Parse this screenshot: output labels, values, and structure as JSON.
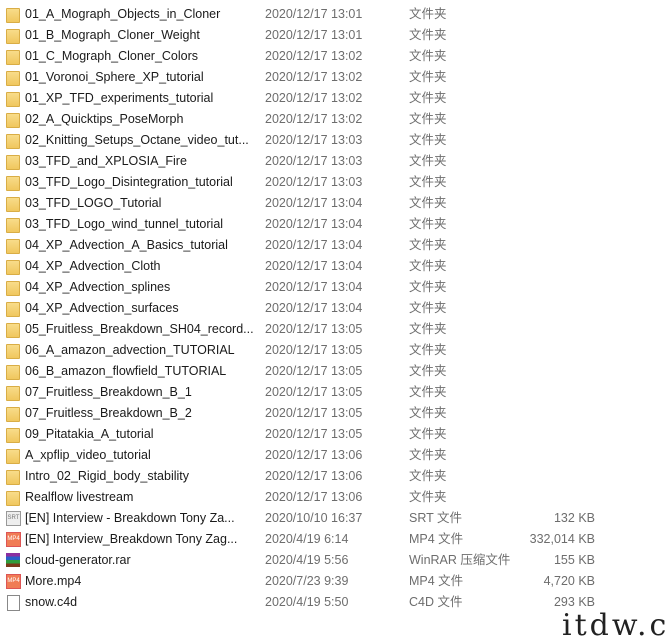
{
  "files": [
    {
      "name": "01_A_Mograph_Objects_in_Cloner",
      "date": "2020/12/17 13:01",
      "type": "文件夹",
      "size": "",
      "icon": "folder"
    },
    {
      "name": "01_B_Mograph_Cloner_Weight",
      "date": "2020/12/17 13:01",
      "type": "文件夹",
      "size": "",
      "icon": "folder"
    },
    {
      "name": "01_C_Mograph_Cloner_Colors",
      "date": "2020/12/17 13:02",
      "type": "文件夹",
      "size": "",
      "icon": "folder"
    },
    {
      "name": "01_Voronoi_Sphere_XP_tutorial",
      "date": "2020/12/17 13:02",
      "type": "文件夹",
      "size": "",
      "icon": "folder"
    },
    {
      "name": "01_XP_TFD_experiments_tutorial",
      "date": "2020/12/17 13:02",
      "type": "文件夹",
      "size": "",
      "icon": "folder"
    },
    {
      "name": "02_A_Quicktips_PoseMorph",
      "date": "2020/12/17 13:02",
      "type": "文件夹",
      "size": "",
      "icon": "folder"
    },
    {
      "name": "02_Knitting_Setups_Octane_video_tut...",
      "date": "2020/12/17 13:03",
      "type": "文件夹",
      "size": "",
      "icon": "folder"
    },
    {
      "name": "03_TFD_and_XPLOSIA_Fire",
      "date": "2020/12/17 13:03",
      "type": "文件夹",
      "size": "",
      "icon": "folder"
    },
    {
      "name": "03_TFD_Logo_Disintegration_tutorial",
      "date": "2020/12/17 13:03",
      "type": "文件夹",
      "size": "",
      "icon": "folder"
    },
    {
      "name": "03_TFD_LOGO_Tutorial",
      "date": "2020/12/17 13:04",
      "type": "文件夹",
      "size": "",
      "icon": "folder"
    },
    {
      "name": "03_TFD_Logo_wind_tunnel_tutorial",
      "date": "2020/12/17 13:04",
      "type": "文件夹",
      "size": "",
      "icon": "folder"
    },
    {
      "name": "04_XP_Advection_A_Basics_tutorial",
      "date": "2020/12/17 13:04",
      "type": "文件夹",
      "size": "",
      "icon": "folder"
    },
    {
      "name": "04_XP_Advection_Cloth",
      "date": "2020/12/17 13:04",
      "type": "文件夹",
      "size": "",
      "icon": "folder"
    },
    {
      "name": "04_XP_Advection_splines",
      "date": "2020/12/17 13:04",
      "type": "文件夹",
      "size": "",
      "icon": "folder"
    },
    {
      "name": "04_XP_Advection_surfaces",
      "date": "2020/12/17 13:04",
      "type": "文件夹",
      "size": "",
      "icon": "folder"
    },
    {
      "name": "05_Fruitless_Breakdown_SH04_record...",
      "date": "2020/12/17 13:05",
      "type": "文件夹",
      "size": "",
      "icon": "folder"
    },
    {
      "name": "06_A_amazon_advection_TUTORIAL",
      "date": "2020/12/17 13:05",
      "type": "文件夹",
      "size": "",
      "icon": "folder"
    },
    {
      "name": "06_B_amazon_flowfield_TUTORIAL",
      "date": "2020/12/17 13:05",
      "type": "文件夹",
      "size": "",
      "icon": "folder"
    },
    {
      "name": "07_Fruitless_Breakdown_B_1",
      "date": "2020/12/17 13:05",
      "type": "文件夹",
      "size": "",
      "icon": "folder"
    },
    {
      "name": "07_Fruitless_Breakdown_B_2",
      "date": "2020/12/17 13:05",
      "type": "文件夹",
      "size": "",
      "icon": "folder"
    },
    {
      "name": "09_Pitatakia_A_tutorial",
      "date": "2020/12/17 13:05",
      "type": "文件夹",
      "size": "",
      "icon": "folder"
    },
    {
      "name": "A_xpflip_video_tutorial",
      "date": "2020/12/17 13:06",
      "type": "文件夹",
      "size": "",
      "icon": "folder"
    },
    {
      "name": "Intro_02_Rigid_body_stability",
      "date": "2020/12/17 13:06",
      "type": "文件夹",
      "size": "",
      "icon": "folder"
    },
    {
      "name": "Realflow livestream",
      "date": "2020/12/17 13:06",
      "type": "文件夹",
      "size": "",
      "icon": "folder"
    },
    {
      "name": "[EN] Interview - Breakdown Tony Za...",
      "date": "2020/10/10 16:37",
      "type": "SRT 文件",
      "size": "132 KB",
      "icon": "srt"
    },
    {
      "name": "[EN] Interview_Breakdown Tony Zag...",
      "date": "2020/4/19 6:14",
      "type": "MP4 文件",
      "size": "332,014 KB",
      "icon": "mp4"
    },
    {
      "name": "cloud-generator.rar",
      "date": "2020/4/19 5:56",
      "type": "WinRAR 压缩文件",
      "size": "155 KB",
      "icon": "rar"
    },
    {
      "name": "More.mp4",
      "date": "2020/7/23 9:39",
      "type": "MP4 文件",
      "size": "4,720 KB",
      "icon": "mp4"
    },
    {
      "name": "snow.c4d",
      "date": "2020/4/19 5:50",
      "type": "C4D 文件",
      "size": "293 KB",
      "icon": "file"
    }
  ],
  "watermark": "itdw.cn"
}
